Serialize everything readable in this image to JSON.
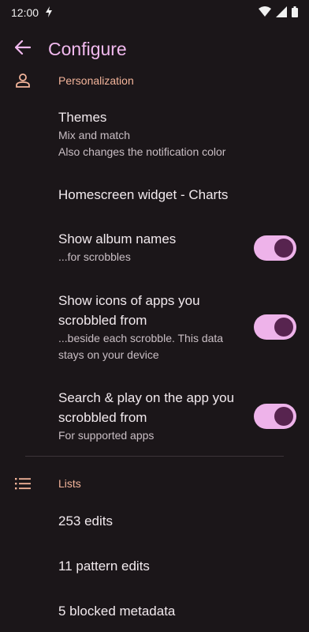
{
  "status_bar": {
    "time": "12:00",
    "icons": [
      "bolt-icon",
      "wifi-icon",
      "signal-icon",
      "battery-icon"
    ]
  },
  "app_bar": {
    "back_icon": "arrow-left-icon",
    "title": "Configure"
  },
  "sections": {
    "personalization": {
      "icon": "person-icon",
      "label": "Personalization",
      "items": {
        "themes": {
          "title": "Themes",
          "subtitle_1": "Mix and match",
          "subtitle_2": "Also changes the notification color"
        },
        "widget": {
          "title": "Homescreen widget - Charts"
        },
        "album_names": {
          "title": "Show album names",
          "subtitle": "...for scrobbles",
          "enabled": true
        },
        "app_icons": {
          "title_1": "Show icons of apps you",
          "title_2": "scrobbled from",
          "subtitle_1": "...beside each scrobble. This data",
          "subtitle_2": "stays on your device",
          "enabled": true
        },
        "search_play": {
          "title_1": "Search & play on the app you",
          "title_2": "scrobbled from",
          "subtitle": "For supported apps",
          "enabled": true
        }
      }
    },
    "lists": {
      "icon": "list-icon",
      "label": "Lists",
      "items": {
        "edits": "253 edits",
        "pattern_edits": "11 pattern edits",
        "blocked_metadata": "5 blocked metadata"
      }
    }
  },
  "colors": {
    "background": "#1b1619",
    "accent_title": "#f1b9ee",
    "section_label": "#f3b49a",
    "switch_track": "#eeb3ea",
    "switch_knob": "#57244f"
  }
}
